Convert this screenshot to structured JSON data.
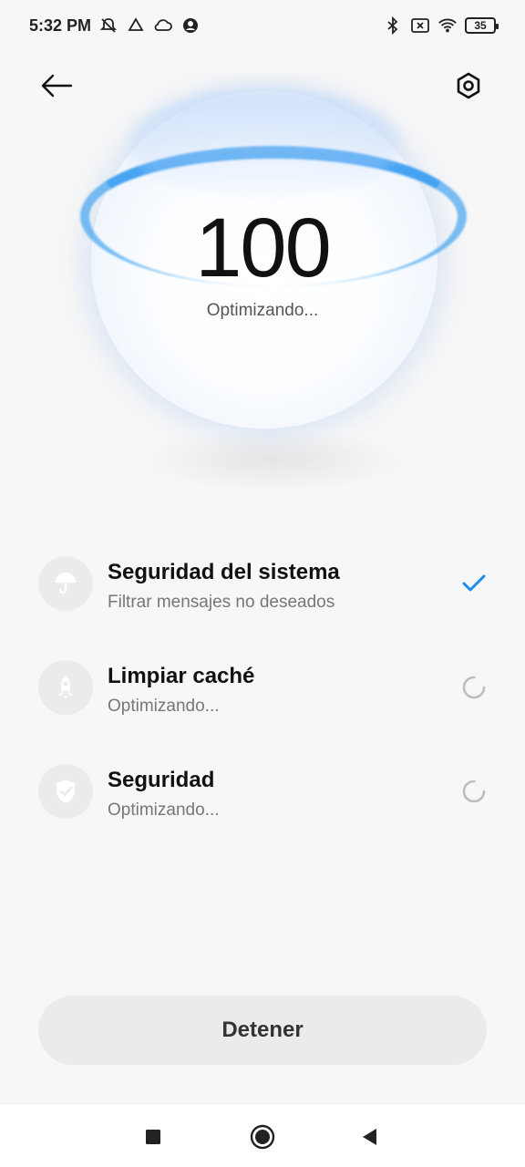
{
  "status_bar": {
    "time": "5:32 PM",
    "left_icons": [
      "alarm-off-icon",
      "drive-icon",
      "cloud-icon",
      "account-icon"
    ],
    "right_icons": [
      "bluetooth-icon",
      "sim-off-icon",
      "wifi-icon"
    ],
    "battery": "35"
  },
  "header": {
    "back_icon": "arrow-left-icon",
    "settings_icon": "gear-icon"
  },
  "hero": {
    "score": "100",
    "status": "Optimizando..."
  },
  "items": [
    {
      "title": "Seguridad del sistema",
      "subtitle": "Filtrar mensajes no deseados",
      "icon": "umbrella-icon",
      "state": "done"
    },
    {
      "title": "Limpiar caché",
      "subtitle": "Optimizando...",
      "icon": "rocket-icon",
      "state": "loading"
    },
    {
      "title": "Seguridad",
      "subtitle": "Optimizando...",
      "icon": "shield-check-icon",
      "state": "loading"
    }
  ],
  "stop_button": {
    "label": "Detener"
  },
  "colors": {
    "accent": "#1f8ce6",
    "background": "#f7f7f7"
  }
}
